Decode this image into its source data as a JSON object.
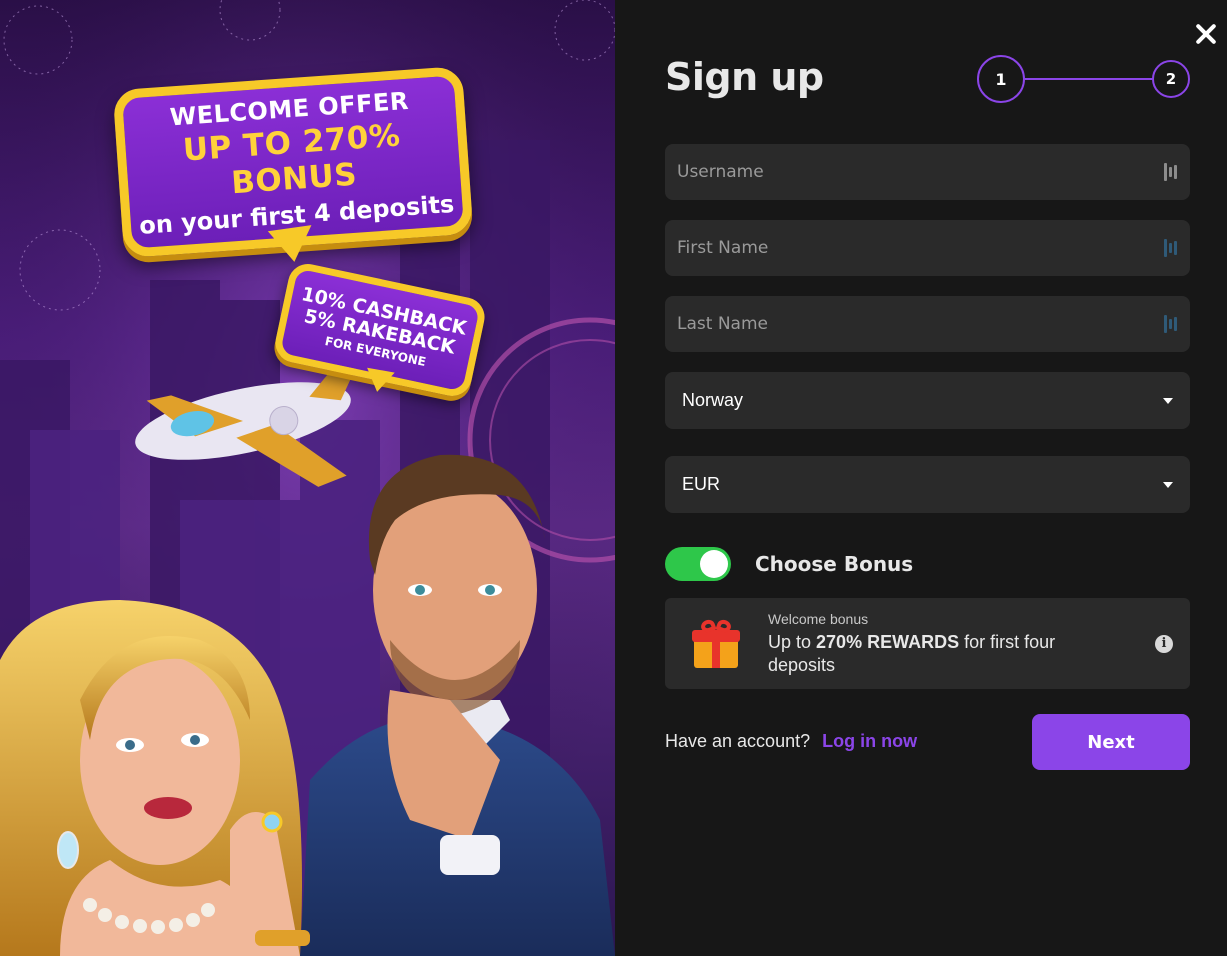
{
  "promo": {
    "welcome_line1": "WELCOME OFFER",
    "welcome_line2": "UP TO 270% BONUS",
    "welcome_line3": "on your first 4 deposits",
    "cashback_line1": "10% CASHBACK",
    "cashback_line2": "5% RAKEBACK",
    "cashback_line3": "FOR EVERYONE"
  },
  "form": {
    "title": "Sign up",
    "steps": [
      "1",
      "2"
    ],
    "active_step": 1,
    "fields": {
      "username_placeholder": "Username",
      "first_name_placeholder": "First Name",
      "last_name_placeholder": "Last Name"
    },
    "country": "Norway",
    "currency": "EUR",
    "bonus_toggle_label": "Choose Bonus",
    "bonus_toggle_on": true,
    "bonus": {
      "caption": "Welcome bonus",
      "text_prefix": "Up to ",
      "text_bold": "270% REWARDS",
      "text_suffix": " for first four deposits"
    },
    "account_question": "Have an account?",
    "login_link": "Log in now",
    "next_button": "Next"
  },
  "colors": {
    "accent": "#8b45e8",
    "toggle_on": "#2ec74a",
    "panel_bg": "#171717",
    "field_bg": "#2a2a2a"
  },
  "icons": [
    "close-icon",
    "password-manager-icon",
    "chevron-down-icon",
    "gift-icon",
    "info-icon"
  ]
}
